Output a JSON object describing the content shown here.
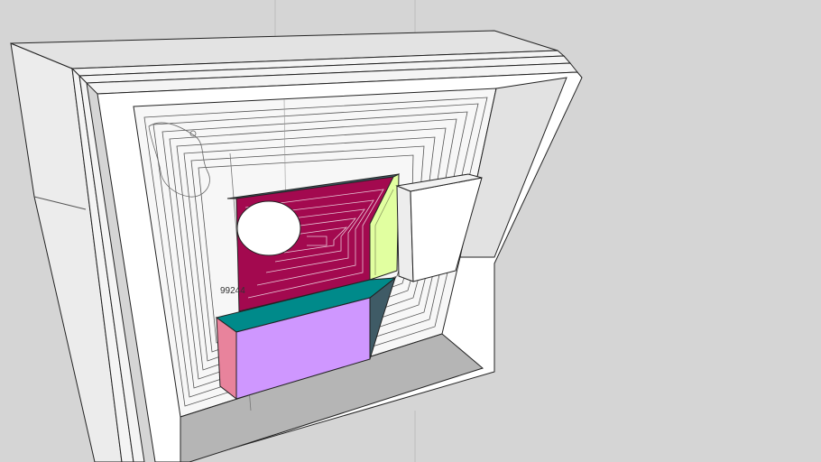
{
  "viewport": {
    "background": "#d5d5d5",
    "edge_color": "#222222",
    "dimension_label": "99244"
  },
  "colors": {
    "panel_crimson": "#a3094f",
    "panel_lime": "#e1ffa0",
    "panel_teal": "#008a8a",
    "panel_lavender": "#cf97ff",
    "panel_pink": "#e8839c",
    "panel_dark_teal": "#3f5b66",
    "face_white": "#ffffff",
    "face_light_gray": "#e6e6e6",
    "face_mid_gray": "#b9b9b9",
    "face_dark_gray": "#9a9a9a"
  }
}
